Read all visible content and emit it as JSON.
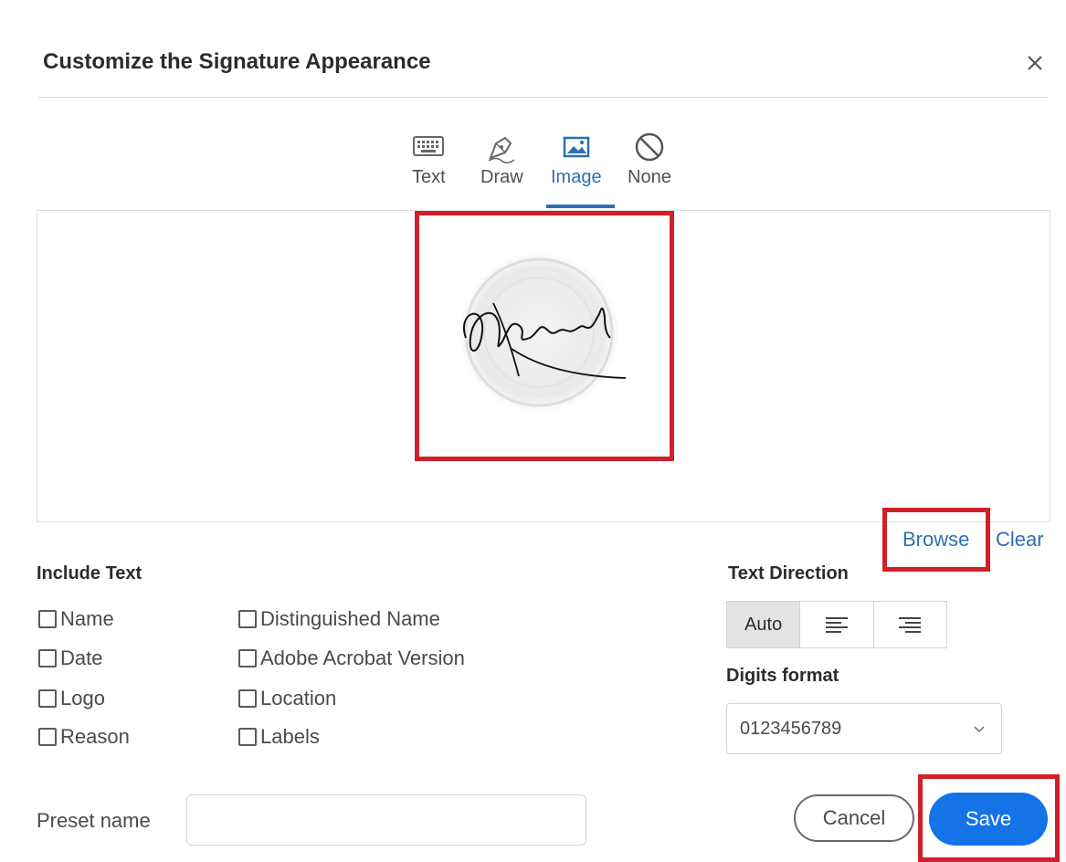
{
  "dialog": {
    "title": "Customize the Signature Appearance",
    "close_icon": "close-icon"
  },
  "tabs": [
    {
      "label": "Text",
      "icon": "keyboard-icon"
    },
    {
      "label": "Draw",
      "icon": "pen-icon"
    },
    {
      "label": "Image",
      "icon": "image-icon",
      "selected": true
    },
    {
      "label": "None",
      "icon": "no-symbol-icon"
    }
  ],
  "canvas": {
    "browse_label": "Browse",
    "clear_label": "Clear"
  },
  "include_text": {
    "heading": "Include Text",
    "options_left": [
      "Name",
      "Date",
      "Logo",
      "Reason"
    ],
    "options_right": [
      "Distinguished Name",
      "Adobe Acrobat Version",
      "Location",
      "Labels"
    ]
  },
  "text_direction": {
    "heading": "Text Direction",
    "options": [
      {
        "label": "Auto",
        "selected": true
      },
      {
        "icon": "align-left-icon"
      },
      {
        "icon": "align-right-icon"
      }
    ]
  },
  "digits_format": {
    "heading": "Digits format",
    "value": "0123456789"
  },
  "preset": {
    "label": "Preset name",
    "value": ""
  },
  "buttons": {
    "cancel": "Cancel",
    "save": "Save"
  },
  "colors": {
    "accent": "#2d6fb5",
    "primary_button": "#1473e6",
    "highlight": "#d0202a"
  }
}
